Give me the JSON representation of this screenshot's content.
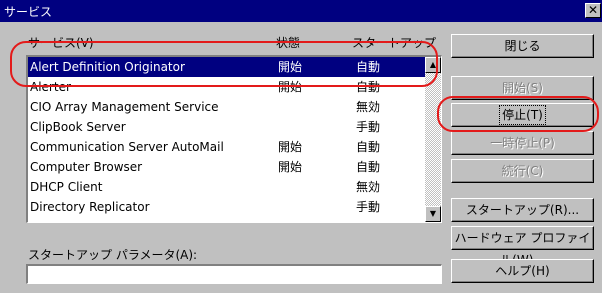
{
  "window": {
    "title": "サービス",
    "close_glyph": "✕"
  },
  "list": {
    "columns": {
      "name": "サービス(V)",
      "status": "状態",
      "startup": "スタートアップ"
    },
    "rows": [
      {
        "name": "Alert Definition Originator",
        "status": "開始",
        "startup": "自動",
        "selected": true
      },
      {
        "name": "Alerter",
        "status": "開始",
        "startup": "自動"
      },
      {
        "name": "CIO Array Management Service",
        "status": "",
        "startup": "無効"
      },
      {
        "name": "ClipBook Server",
        "status": "",
        "startup": "手動"
      },
      {
        "name": "Communication Server AutoMail",
        "status": "開始",
        "startup": "自動"
      },
      {
        "name": "Computer Browser",
        "status": "開始",
        "startup": "自動"
      },
      {
        "name": "DHCP Client",
        "status": "",
        "startup": "無効"
      },
      {
        "name": "Directory Replicator",
        "status": "",
        "startup": "手動"
      }
    ]
  },
  "scrollbar": {
    "up_glyph": "▲",
    "down_glyph": "▼"
  },
  "buttons": {
    "close": "閉じる",
    "start": "開始(S)",
    "stop": "停止(T)",
    "pause": "一時停止(P)",
    "resume": "続行(C)",
    "startup": "スタートアップ(R)...",
    "hw_profile": "ハードウェア プロファイル(W)...",
    "help": "ヘルプ(H)"
  },
  "startup_params": {
    "label": "スタートアップ パラメータ(A):",
    "value": ""
  },
  "colors": {
    "title_bar": "#000080",
    "selection": "#000080",
    "annotation": "#e31a1a",
    "face": "#c0c0c0"
  }
}
